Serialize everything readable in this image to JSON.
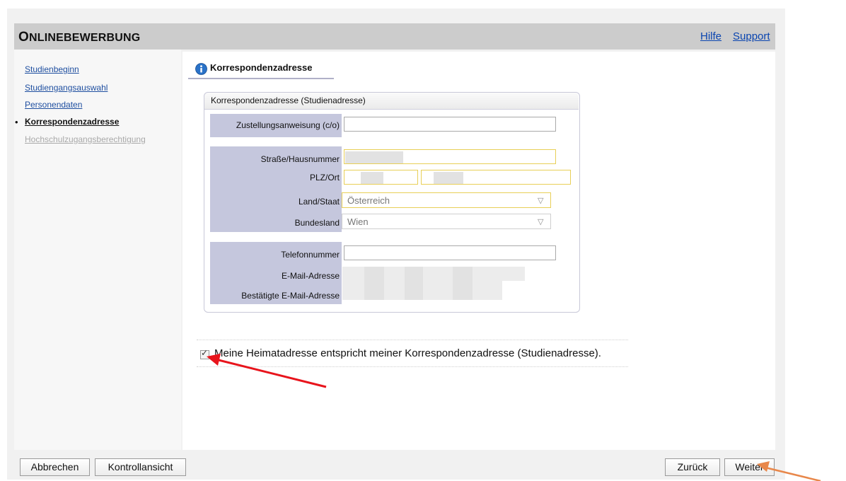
{
  "header": {
    "title_first_letter": "O",
    "title_rest": "NLINEBEWERBUNG",
    "links": [
      "Hilfe",
      "Support"
    ]
  },
  "sidebar": {
    "items": [
      {
        "label": "Studienbeginn",
        "state": "link"
      },
      {
        "label": "Studiengangsauswahl",
        "state": "link"
      },
      {
        "label": "Personendaten",
        "state": "link"
      },
      {
        "label": "Korrespondenzadresse",
        "state": "active"
      },
      {
        "label": "Hochschulzugangsberechtigung",
        "state": "disabled"
      }
    ]
  },
  "main": {
    "tab_label": "Korrespondenzadresse",
    "info_icon": "info-icon",
    "box_title": "Korrespondenzadresse (Studienadresse)",
    "fields": {
      "co_label": "Zustellungsanweisung (c/o)",
      "co_value": "",
      "street_label": "Straße/Hausnummer",
      "plz_label": "PLZ/Ort",
      "country_label": "Land/Staat",
      "country_value": "Österreich",
      "state_label": "Bundesland",
      "state_value": "Wien",
      "phone_label": "Telefonnummer",
      "phone_value": "",
      "email_label": "E-Mail-Adresse",
      "email_confirmed_label": "Bestätigte E-Mail-Adresse"
    },
    "home_address_checkbox": {
      "label": "Meine Heimatadresse entspricht meiner Korrespondenzadresse (Studienadresse).",
      "checked": true
    }
  },
  "footer": {
    "left_buttons": [
      "Abbrechen",
      "Kontrollansicht"
    ],
    "right_buttons": [
      "Zurück",
      "Weiter"
    ]
  },
  "colors": {
    "header_bg": "#cccccc",
    "label_bg": "#c5c7dd",
    "required_border": "#e8cf57",
    "link": "#1f4fa0",
    "annotation_red": "#e8141c",
    "annotation_orange": "#e8874a"
  }
}
